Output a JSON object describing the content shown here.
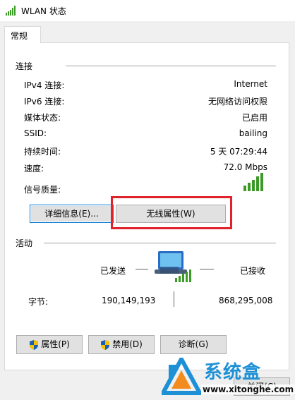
{
  "window": {
    "title": "WLAN 状态"
  },
  "tabs": [
    {
      "label": "常规"
    }
  ],
  "connection": {
    "group_title": "连接",
    "rows": [
      {
        "label": "IPv4 连接:",
        "value": "Internet"
      },
      {
        "label": "IPv6 连接:",
        "value": "无网络访问权限"
      },
      {
        "label": "媒体状态:",
        "value": "已启用"
      },
      {
        "label": "SSID:",
        "value": "bailing"
      },
      {
        "label": "持续时间:",
        "value": "5 天 07:29:44"
      },
      {
        "label": "速度:",
        "value": "72.0 Mbps"
      }
    ],
    "signal": {
      "label": "信号质量:",
      "bars_total": 5,
      "bars_active": 5
    },
    "details_button": "详细信息(E)...",
    "wireless_button": "无线属性(W)"
  },
  "activity": {
    "group_title": "活动",
    "sent_label": "已发送",
    "received_label": "已接收",
    "bytes_label": "字节:",
    "bytes_sent": "190,149,193",
    "bytes_received": "868,295,008"
  },
  "buttons": {
    "properties": "属性(P)",
    "disable": "禁用(D)",
    "diagnose": "诊断(G)",
    "close": "关闭(C)"
  },
  "watermark": {
    "brand": "系统盒",
    "url": "www.xitonghe.com"
  },
  "colors": {
    "signal_green": "#3c9a26",
    "highlight_red": "#e0232a",
    "focus_blue": "#0078d7",
    "watermark_blue": "#1e90d6"
  }
}
